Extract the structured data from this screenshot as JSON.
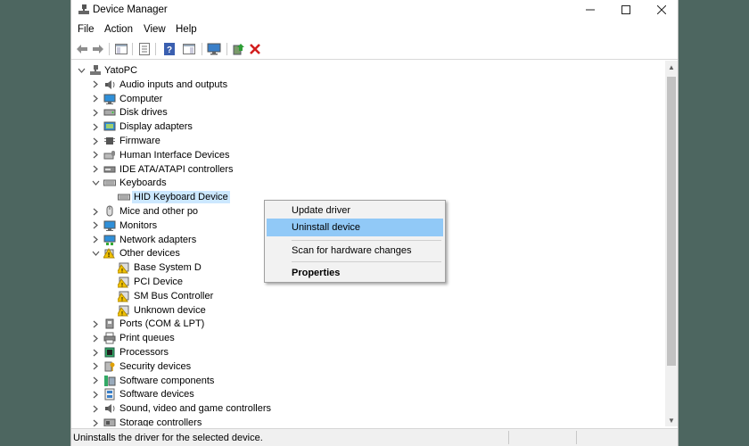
{
  "window": {
    "title": "Device Manager"
  },
  "menu": [
    "File",
    "Action",
    "View",
    "Help"
  ],
  "root": "YatoPC",
  "tree": [
    {
      "label": "Audio inputs and outputs",
      "icon": "speaker-icon",
      "level": 1,
      "expand": "collapsed"
    },
    {
      "label": "Computer",
      "icon": "computer-monitor-icon",
      "level": 1,
      "expand": "collapsed"
    },
    {
      "label": "Disk drives",
      "icon": "disk-drive-icon",
      "level": 1,
      "expand": "collapsed"
    },
    {
      "label": "Display adapters",
      "icon": "display-adapter-icon",
      "level": 1,
      "expand": "collapsed"
    },
    {
      "label": "Firmware",
      "icon": "firmware-chip-icon",
      "level": 1,
      "expand": "collapsed"
    },
    {
      "label": "Human Interface Devices",
      "icon": "hid-icon",
      "level": 1,
      "expand": "collapsed"
    },
    {
      "label": "IDE ATA/ATAPI controllers",
      "icon": "ide-controller-icon",
      "level": 1,
      "expand": "collapsed"
    },
    {
      "label": "Keyboards",
      "icon": "keyboard-icon",
      "level": 1,
      "expand": "expanded"
    },
    {
      "label": "HID Keyboard Device",
      "icon": "keyboard-icon",
      "level": 2,
      "expand": "none",
      "selected": true
    },
    {
      "label": "Mice and other po",
      "icon": "mouse-icon",
      "level": 1,
      "expand": "collapsed"
    },
    {
      "label": "Monitors",
      "icon": "monitor-icon",
      "level": 1,
      "expand": "collapsed"
    },
    {
      "label": "Network adapters",
      "icon": "network-adapter-icon",
      "level": 1,
      "expand": "collapsed"
    },
    {
      "label": "Other devices",
      "icon": "other-devices-icon",
      "level": 1,
      "expand": "expanded"
    },
    {
      "label": "Base System D",
      "icon": "warning-device-icon",
      "level": 2,
      "expand": "none"
    },
    {
      "label": "PCI Device",
      "icon": "warning-device-icon",
      "level": 2,
      "expand": "none"
    },
    {
      "label": "SM Bus Controller",
      "icon": "warning-device-icon",
      "level": 2,
      "expand": "none"
    },
    {
      "label": "Unknown device",
      "icon": "warning-device-icon",
      "level": 2,
      "expand": "none"
    },
    {
      "label": "Ports (COM & LPT)",
      "icon": "port-icon",
      "level": 1,
      "expand": "collapsed"
    },
    {
      "label": "Print queues",
      "icon": "printer-icon",
      "level": 1,
      "expand": "collapsed"
    },
    {
      "label": "Processors",
      "icon": "processor-icon",
      "level": 1,
      "expand": "collapsed"
    },
    {
      "label": "Security devices",
      "icon": "security-key-icon",
      "level": 1,
      "expand": "collapsed"
    },
    {
      "label": "Software components",
      "icon": "software-component-icon",
      "level": 1,
      "expand": "collapsed"
    },
    {
      "label": "Software devices",
      "icon": "software-device-icon",
      "level": 1,
      "expand": "collapsed"
    },
    {
      "label": "Sound, video and game controllers",
      "icon": "sound-controller-icon",
      "level": 1,
      "expand": "collapsed"
    },
    {
      "label": "Storage controllers",
      "icon": "storage-controller-icon",
      "level": 1,
      "expand": "collapsed"
    }
  ],
  "context_menu": {
    "update": "Update driver",
    "uninstall": "Uninstall device",
    "scan": "Scan for hardware changes",
    "properties": "Properties"
  },
  "status": "Uninstalls the driver for the selected device.",
  "colors": {
    "selection": "#cce8ff",
    "menu_highlight": "#91c9f7",
    "uninstall_red": "#d21e1e"
  }
}
